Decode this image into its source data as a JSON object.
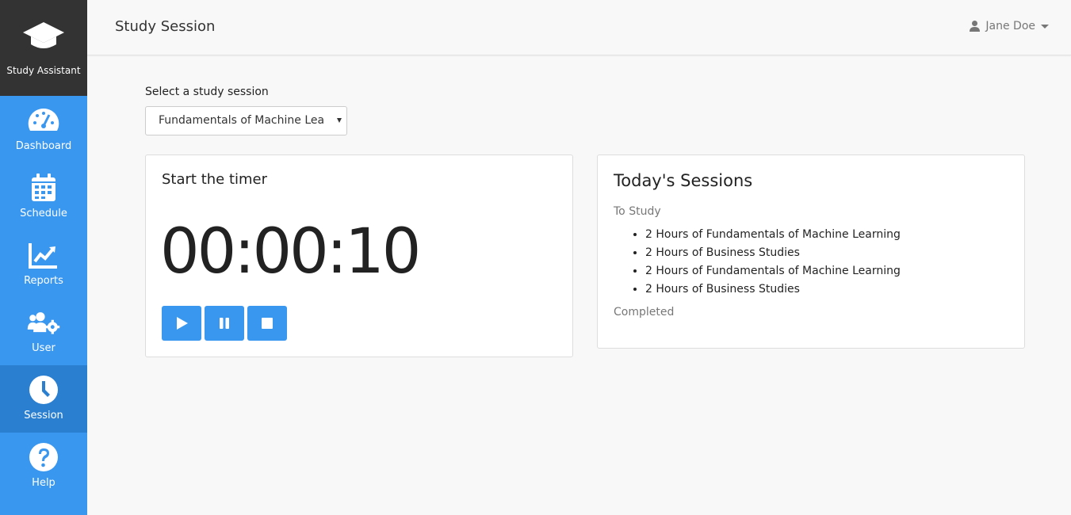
{
  "brand": {
    "label": "Study Assistant",
    "icon": "graduation-cap-icon"
  },
  "sidebar": {
    "items": [
      {
        "label": "Dashboard",
        "icon": "tachometer-icon",
        "active": false
      },
      {
        "label": "Schedule",
        "icon": "calendar-icon",
        "active": false
      },
      {
        "label": "Reports",
        "icon": "line-chart-icon",
        "active": false
      },
      {
        "label": "User",
        "icon": "users-cog-icon",
        "active": false
      },
      {
        "label": "Session",
        "icon": "clock-icon",
        "active": true
      },
      {
        "label": "Help",
        "icon": "question-circle-icon",
        "active": false
      }
    ]
  },
  "header": {
    "title": "Study Session",
    "user_name": "Jane Doe"
  },
  "session_select": {
    "label": "Select a study session",
    "value": "Fundamentals of Machine Learning"
  },
  "timer": {
    "title": "Start the timer",
    "display": "00:00:10",
    "buttons": [
      "play",
      "pause",
      "stop"
    ]
  },
  "today": {
    "title": "Today's Sessions",
    "to_study_label": "To Study",
    "to_study": [
      "2 Hours of Fundamentals of Machine Learning",
      "2 Hours of Business Studies",
      "2 Hours of Fundamentals of Machine Learning",
      "2 Hours of Business Studies"
    ],
    "completed_label": "Completed"
  },
  "colors": {
    "accent": "#3a97f0",
    "accent_active": "#2a7fd0",
    "brand_bg": "#333333"
  }
}
